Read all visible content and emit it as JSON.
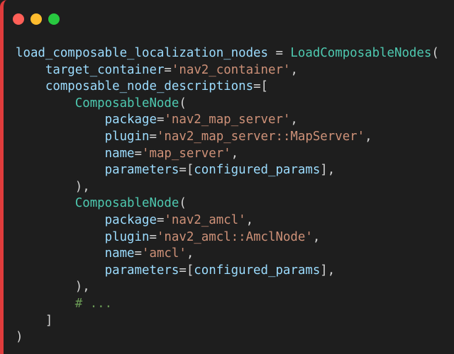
{
  "window": {
    "controls": [
      {
        "name": "close",
        "color": "#ff5f57"
      },
      {
        "name": "minimize",
        "color": "#febc2e"
      },
      {
        "name": "maximize",
        "color": "#28c840"
      }
    ]
  },
  "code": {
    "language": "python",
    "lines": [
      [
        {
          "t": "var",
          "v": "load_composable_localization_nodes"
        },
        {
          "t": "punc",
          "v": " = "
        },
        {
          "t": "fn",
          "v": "LoadComposableNodes"
        },
        {
          "t": "punc",
          "v": "("
        }
      ],
      [
        {
          "t": "punc",
          "v": "    "
        },
        {
          "t": "var",
          "v": "target_container"
        },
        {
          "t": "punc",
          "v": "="
        },
        {
          "t": "str",
          "v": "'nav2_container'"
        },
        {
          "t": "punc",
          "v": ","
        }
      ],
      [
        {
          "t": "punc",
          "v": "    "
        },
        {
          "t": "var",
          "v": "composable_node_descriptions"
        },
        {
          "t": "punc",
          "v": "=["
        }
      ],
      [
        {
          "t": "punc",
          "v": "        "
        },
        {
          "t": "fn",
          "v": "ComposableNode"
        },
        {
          "t": "punc",
          "v": "("
        }
      ],
      [
        {
          "t": "punc",
          "v": "            "
        },
        {
          "t": "var",
          "v": "package"
        },
        {
          "t": "punc",
          "v": "="
        },
        {
          "t": "str",
          "v": "'nav2_map_server'"
        },
        {
          "t": "punc",
          "v": ","
        }
      ],
      [
        {
          "t": "punc",
          "v": "            "
        },
        {
          "t": "var",
          "v": "plugin"
        },
        {
          "t": "punc",
          "v": "="
        },
        {
          "t": "str",
          "v": "'nav2_map_server::MapServer'"
        },
        {
          "t": "punc",
          "v": ","
        }
      ],
      [
        {
          "t": "punc",
          "v": "            "
        },
        {
          "t": "var",
          "v": "name"
        },
        {
          "t": "punc",
          "v": "="
        },
        {
          "t": "str",
          "v": "'map_server'"
        },
        {
          "t": "punc",
          "v": ","
        }
      ],
      [
        {
          "t": "punc",
          "v": "            "
        },
        {
          "t": "var",
          "v": "parameters"
        },
        {
          "t": "punc",
          "v": "=["
        },
        {
          "t": "var",
          "v": "configured_params"
        },
        {
          "t": "punc",
          "v": "],"
        }
      ],
      [
        {
          "t": "punc",
          "v": "        ),"
        }
      ],
      [
        {
          "t": "punc",
          "v": "        "
        },
        {
          "t": "fn",
          "v": "ComposableNode"
        },
        {
          "t": "punc",
          "v": "("
        }
      ],
      [
        {
          "t": "punc",
          "v": "            "
        },
        {
          "t": "var",
          "v": "package"
        },
        {
          "t": "punc",
          "v": "="
        },
        {
          "t": "str",
          "v": "'nav2_amcl'"
        },
        {
          "t": "punc",
          "v": ","
        }
      ],
      [
        {
          "t": "punc",
          "v": "            "
        },
        {
          "t": "var",
          "v": "plugin"
        },
        {
          "t": "punc",
          "v": "="
        },
        {
          "t": "str",
          "v": "'nav2_amcl::AmclNode'"
        },
        {
          "t": "punc",
          "v": ","
        }
      ],
      [
        {
          "t": "punc",
          "v": "            "
        },
        {
          "t": "var",
          "v": "name"
        },
        {
          "t": "punc",
          "v": "="
        },
        {
          "t": "str",
          "v": "'amcl'"
        },
        {
          "t": "punc",
          "v": ","
        }
      ],
      [
        {
          "t": "punc",
          "v": "            "
        },
        {
          "t": "var",
          "v": "parameters"
        },
        {
          "t": "punc",
          "v": "=["
        },
        {
          "t": "var",
          "v": "configured_params"
        },
        {
          "t": "punc",
          "v": "],"
        }
      ],
      [
        {
          "t": "punc",
          "v": "        ),"
        }
      ],
      [
        {
          "t": "punc",
          "v": "        "
        },
        {
          "t": "cmt",
          "v": "# ..."
        }
      ],
      [
        {
          "t": "punc",
          "v": "    ]"
        }
      ],
      [
        {
          "t": "punc",
          "v": ")"
        }
      ]
    ]
  }
}
